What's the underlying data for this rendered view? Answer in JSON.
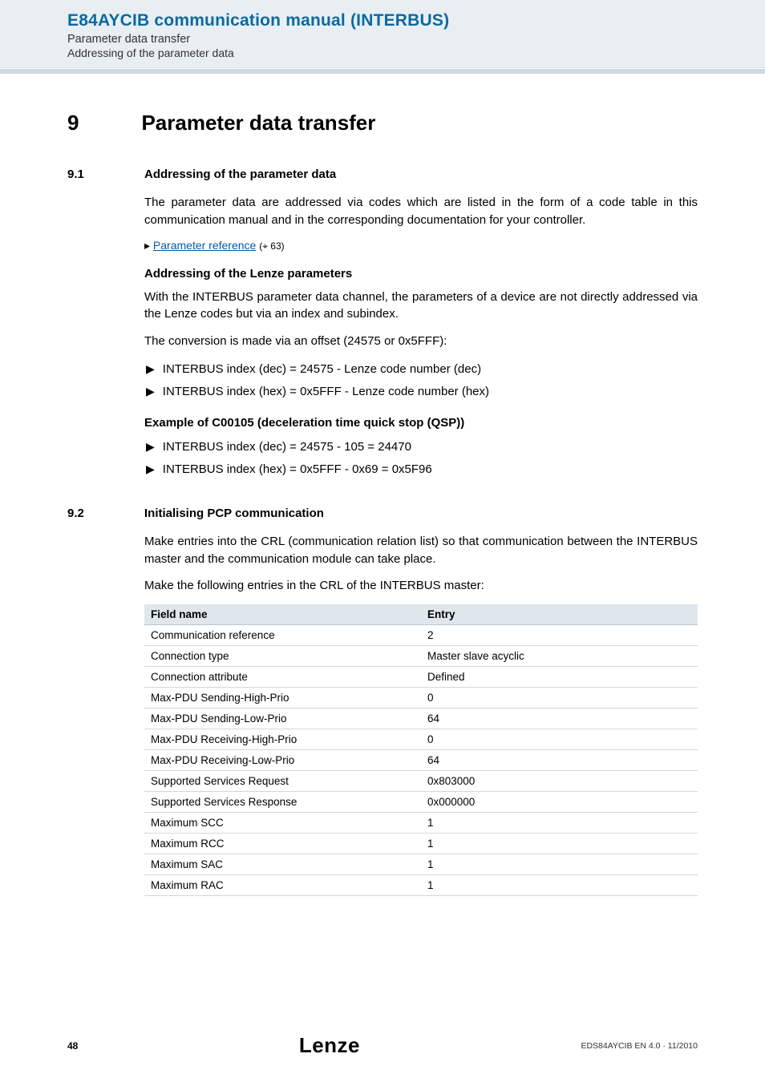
{
  "header": {
    "title": "E84AYCIB communication manual (INTERBUS)",
    "sub1": "Parameter data transfer",
    "sub2": "Addressing of the parameter data"
  },
  "chapter": {
    "num": "9",
    "title": "Parameter data transfer"
  },
  "sec91": {
    "num": "9.1",
    "title": "Addressing of the parameter data",
    "para1": "The parameter data are addressed via codes which are listed in the form of a code table in this communication manual and in the corresponding documentation for your controller.",
    "xref_label": "Parameter reference",
    "xref_page": "(⌖ 63)",
    "sub1_title": "Addressing of the Lenze parameters",
    "sub1_p1": "With the INTERBUS parameter data channel, the parameters of a device are not directly addressed via the Lenze codes but via an index and subindex.",
    "sub1_p2": "The conversion is made via an offset (24575 or 0x5FFF):",
    "sub1_b1": "INTERBUS index (dec) = 24575 - Lenze code number (dec)",
    "sub1_b2": "INTERBUS index (hex) = 0x5FFF - Lenze code number (hex)",
    "sub2_title": "Example of C00105 (deceleration time quick stop (QSP))",
    "sub2_b1": "INTERBUS index (dec) = 24575 - 105 = 24470",
    "sub2_b2": "INTERBUS index (hex) = 0x5FFF - 0x69 = 0x5F96"
  },
  "sec92": {
    "num": "9.2",
    "title": "Initialising PCP communication",
    "p1": "Make entries into the CRL (communication relation list) so that communication between the INTERBUS master and the communication module can take place.",
    "p2": "Make the following entries in the CRL of the INTERBUS master:",
    "th1": "Field name",
    "th2": "Entry",
    "rows": [
      {
        "f": "Communication reference",
        "e": "2"
      },
      {
        "f": "Connection type",
        "e": "Master slave acyclic"
      },
      {
        "f": "Connection attribute",
        "e": "Defined"
      },
      {
        "f": "Max-PDU Sending-High-Prio",
        "e": "0"
      },
      {
        "f": "Max-PDU Sending-Low-Prio",
        "e": "64"
      },
      {
        "f": "Max-PDU Receiving-High-Prio",
        "e": "0"
      },
      {
        "f": "Max-PDU Receiving-Low-Prio",
        "e": "64"
      },
      {
        "f": "Supported Services Request",
        "e": "0x803000"
      },
      {
        "f": "Supported Services Response",
        "e": "0x000000"
      },
      {
        "f": "Maximum SCC",
        "e": "1"
      },
      {
        "f": "Maximum RCC",
        "e": "1"
      },
      {
        "f": "Maximum SAC",
        "e": "1"
      },
      {
        "f": "Maximum RAC",
        "e": "1"
      }
    ]
  },
  "footer": {
    "page": "48",
    "logo": "Lenze",
    "ref": "EDS84AYCIB EN 4.0 · 11/2010"
  }
}
